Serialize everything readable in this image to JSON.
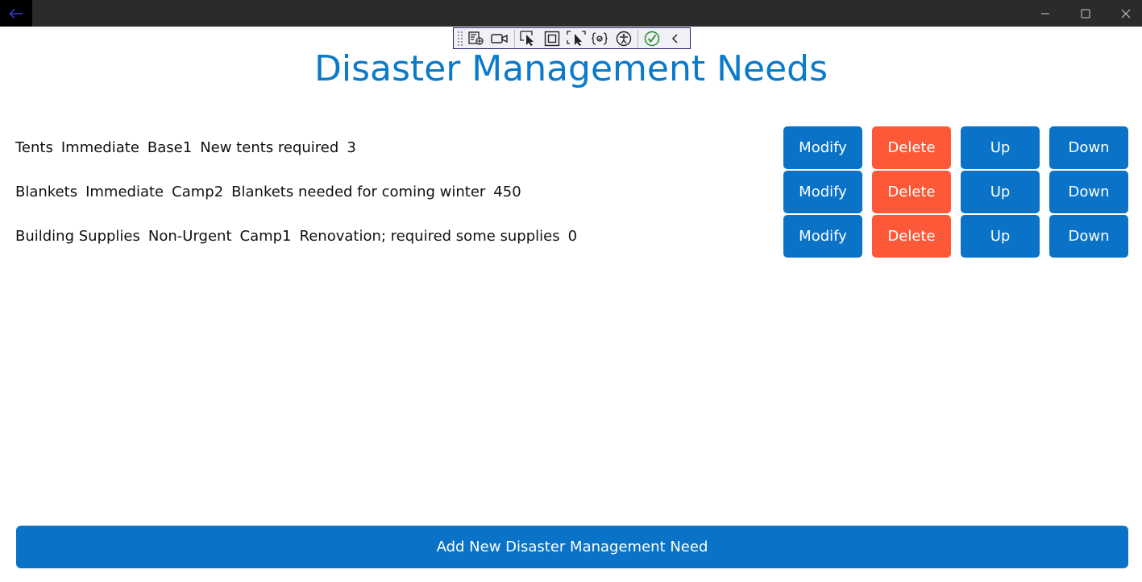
{
  "app": {
    "title": "Disaster Management Needs"
  },
  "window": {
    "back_icon": "arrow-left-icon",
    "minimize_icon": "minimize-icon",
    "maximize_icon": "maximize-icon",
    "close_icon": "close-icon"
  },
  "debug_toolbar": {
    "icons": [
      "grip-icon",
      "live-visual-tree-icon",
      "record-icon",
      "select-element-icon",
      "display-layout-adorners-icon",
      "track-focus-icon",
      "binding-failures-icon",
      "accessibility-checker-icon",
      "hot-reload-status-icon",
      "collapse-chevron-icon"
    ]
  },
  "needs": [
    {
      "item": "Tents",
      "priority": "Immediate",
      "location": "Base1",
      "description": "New tents required",
      "quantity": "3"
    },
    {
      "item": "Blankets",
      "priority": "Immediate",
      "location": "Camp2",
      "description": "Blankets needed for coming winter",
      "quantity": "450"
    },
    {
      "item": "Building Supplies",
      "priority": "Non-Urgent",
      "location": "Camp1",
      "description": "Renovation; required some supplies",
      "quantity": "0"
    }
  ],
  "row_actions": {
    "modify": "Modify",
    "delete": "Delete",
    "up": "Up",
    "down": "Down"
  },
  "add_button": "Add New Disaster Management Need",
  "colors": {
    "accent": "#0a73c8",
    "title": "#0a7acb",
    "danger": "#fd5938",
    "titlebar": "#2b2b2b"
  }
}
